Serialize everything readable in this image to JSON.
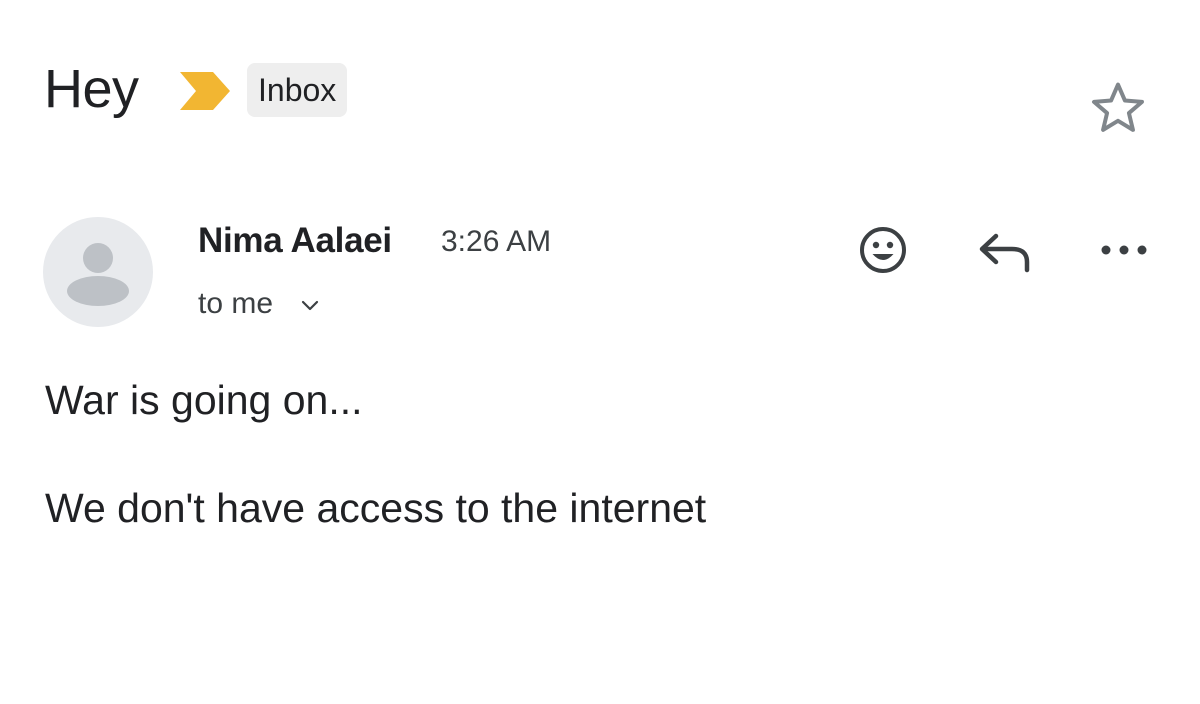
{
  "email": {
    "subject": "Hey",
    "label": "Inbox",
    "importance_icon": "importance-marker-icon",
    "star_icon": "star-outline-icon"
  },
  "message": {
    "sender_name": "Nima Aalaei",
    "time": "3:26 AM",
    "recipient": "to me",
    "body_lines": [
      "War is going on...",
      "We don't have access to the internet"
    ]
  },
  "actions": {
    "emoji_icon": "add-reaction-icon",
    "reply_icon": "reply-icon",
    "more_icon": "more-options-icon"
  },
  "colors": {
    "importance": "#F2B632",
    "label_background": "#EEEEEE",
    "avatar_background": "#E8EAED",
    "avatar_glyph": "#BDC1C6",
    "icon": "#3C4043",
    "star": "#80868B"
  }
}
